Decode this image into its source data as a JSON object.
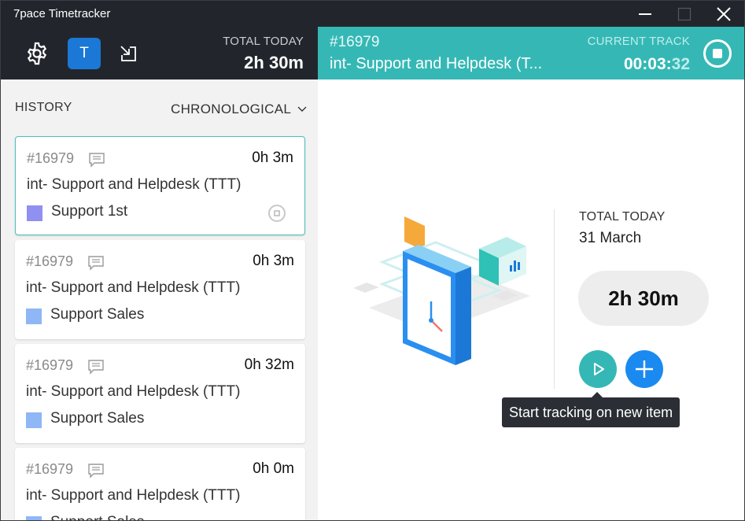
{
  "window": {
    "title": "7pace Timetracker"
  },
  "header": {
    "avatar_initial": "T",
    "total_today_label": "TOTAL TODAY",
    "total_today_value": "2h 30m"
  },
  "current_track": {
    "id": "#16979",
    "title": "int- Support and Helpdesk (T...",
    "label": "CURRENT TRACK",
    "time_main": "00:03:",
    "time_seconds": "32"
  },
  "history": {
    "label": "HISTORY",
    "sort": "CHRONOLOGICAL",
    "items": [
      {
        "id": "#16979",
        "duration": "0h 3m",
        "title": "int- Support and Helpdesk (TTT)",
        "tag": "Support 1st",
        "tag_color": "#9090f0"
      },
      {
        "id": "#16979",
        "duration": "0h 3m",
        "title": "int- Support and Helpdesk (TTT)",
        "tag": "Support Sales",
        "tag_color": "#8fb6f5"
      },
      {
        "id": "#16979",
        "duration": "0h 32m",
        "title": "int- Support and Helpdesk (TTT)",
        "tag": "Support Sales",
        "tag_color": "#8fb6f5"
      },
      {
        "id": "#16979",
        "duration": "0h 0m",
        "title": "int- Support and Helpdesk (TTT)",
        "tag": "Support Sales",
        "tag_color": "#8fb6f5"
      }
    ]
  },
  "summary": {
    "label": "TOTAL TODAY",
    "date": "31 March",
    "total": "2h 30m"
  },
  "tooltip": {
    "text": "Start tracking on new item"
  },
  "colors": {
    "accent": "#35b8b5",
    "blue": "#1b8af0",
    "header_dark": "#22262c"
  }
}
